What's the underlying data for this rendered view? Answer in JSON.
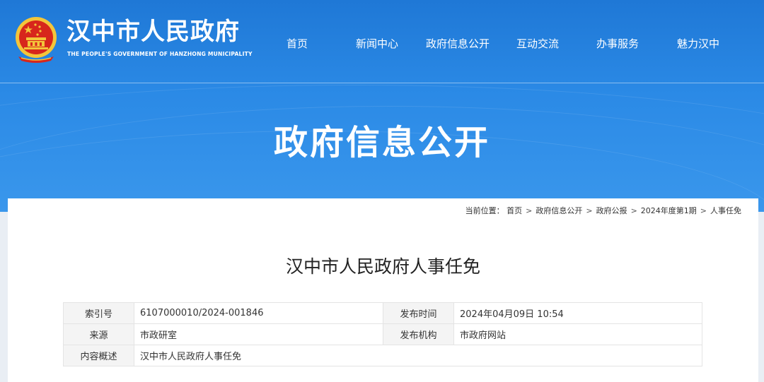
{
  "site": {
    "title": "汉中市人民政府",
    "subtitle": "THE PEOPLE'S GOVERNMENT OF HANZHONG MUNICIPALITY"
  },
  "nav": [
    {
      "label": "首页"
    },
    {
      "label": "新闻中心"
    },
    {
      "label": "政府信息公开"
    },
    {
      "label": "互动交流"
    },
    {
      "label": "办事服务"
    },
    {
      "label": "魅力汉中"
    }
  ],
  "banner": {
    "title": "政府信息公开"
  },
  "breadcrumb": {
    "prefix": "当前位置：",
    "items": [
      "首页",
      "政府信息公开",
      "政府公报",
      "2024年度第1期",
      "人事任免"
    ]
  },
  "article": {
    "title": "汉中市人民政府人事任免",
    "meta": {
      "index_label": "索引号",
      "index_value": "6107000010/2024-001846",
      "date_label": "发布时间",
      "date_value": "2024年04月09日 10:54",
      "source_label": "来源",
      "source_value": "市政研室",
      "org_label": "发布机构",
      "org_value": "市政府网站",
      "summary_label": "内容概述",
      "summary_value": "汉中市人民政府人事任免"
    }
  },
  "colors": {
    "header_blue": "#1f78d6",
    "emblem_red": "#d7261c",
    "emblem_gold": "#f3c53a"
  },
  "icons": {
    "emblem": "national-emblem-icon"
  }
}
